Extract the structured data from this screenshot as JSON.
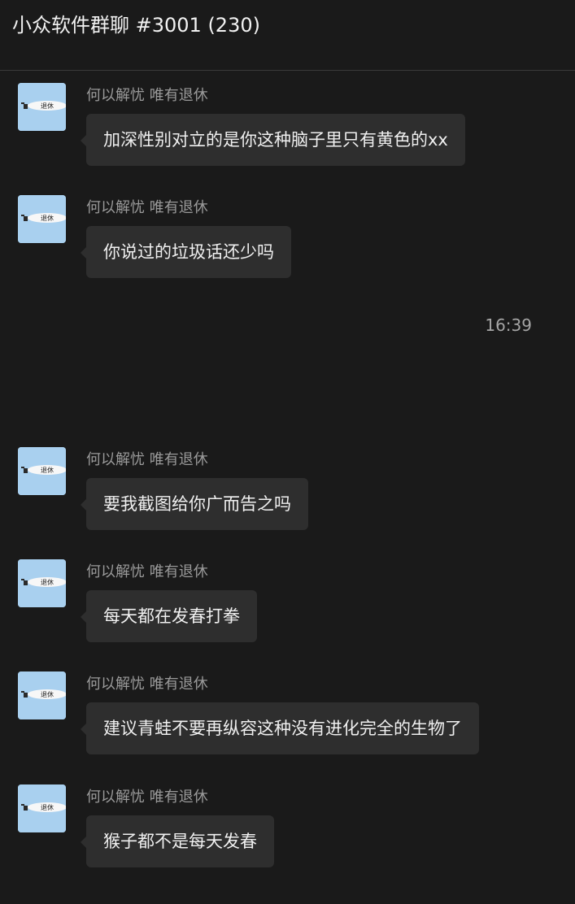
{
  "header": {
    "title": "小众软件群聊 #3001 (230)"
  },
  "timestamp": "16:39",
  "avatar_text": "退休",
  "messages": [
    {
      "sender": "何以解忧 唯有退休",
      "text": "加深性别对立的是你这种脑子里只有黄色的xx"
    },
    {
      "sender": "何以解忧 唯有退休",
      "text": "你说过的垃圾话还少吗"
    },
    {
      "sender": "何以解忧 唯有退休",
      "text": "要我截图给你广而告之吗"
    },
    {
      "sender": "何以解忧 唯有退休",
      "text": "每天都在发春打拳"
    },
    {
      "sender": "何以解忧 唯有退休",
      "text": "建议青蛙不要再纵容这种没有进化完全的生物了"
    },
    {
      "sender": "何以解忧 唯有退休",
      "text": "猴子都不是每天发春"
    }
  ],
  "colors": {
    "background": "#1a1a1a",
    "bubble": "#2e2e2e",
    "avatar": "#a9d0ef",
    "sender_text": "#9a9a9a"
  }
}
